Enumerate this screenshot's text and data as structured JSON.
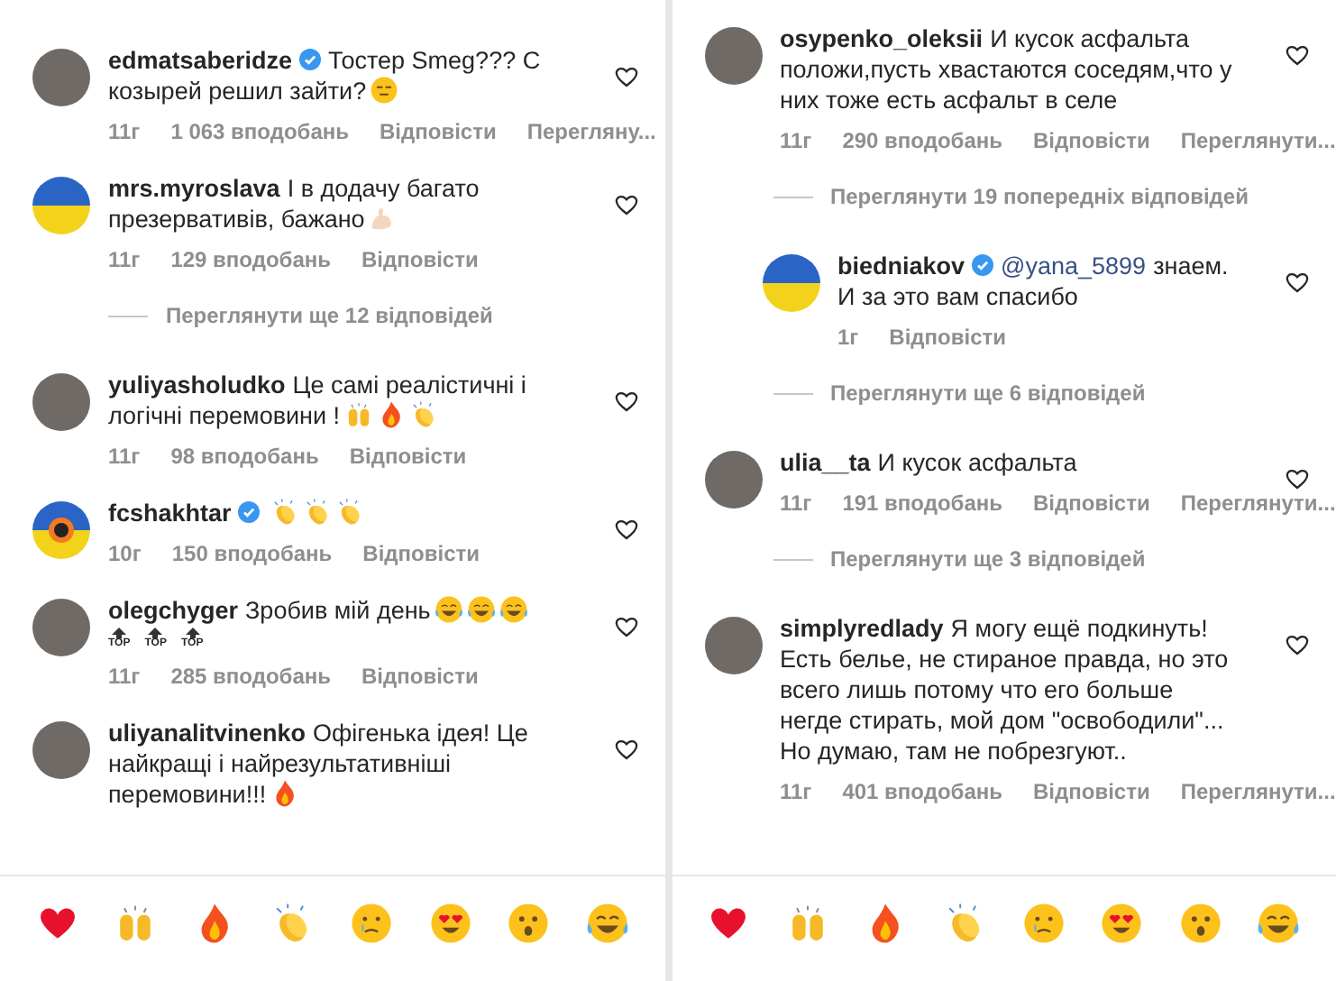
{
  "panels": [
    {
      "items": [
        {
          "kind": "comment",
          "avatar": {
            "kind": "photo"
          },
          "indented": false,
          "username": "edmatsaberidze",
          "verified": true,
          "text": "Тостер Smeg??? С козырей решил зайти?",
          "emojis": [
            {
              "kind": "expressionless"
            }
          ],
          "meta": {
            "time": "11г",
            "likes": "1 063 вподобань",
            "reply": "Відповісти",
            "view": "Перегляну..."
          }
        },
        {
          "kind": "comment",
          "avatar": {
            "kind": "flag"
          },
          "indented": false,
          "username": "mrs.myroslava",
          "verified": false,
          "text": "І в додачу багато презервативів, бажано",
          "emojis": [
            {
              "kind": "muscle"
            }
          ],
          "meta": {
            "time": "11г",
            "likes": "129 вподобань",
            "reply": "Відповісти"
          }
        },
        {
          "kind": "more",
          "label": "Переглянути ще 12 відповідей"
        },
        {
          "kind": "comment",
          "avatar": {
            "kind": "photo"
          },
          "indented": false,
          "username": "yuliyasholudko",
          "verified": false,
          "text": "Це самі реалістичні і логічні перемовини !",
          "emojis": [
            {
              "kind": "hands"
            },
            {
              "kind": "fire"
            },
            {
              "kind": "clap"
            }
          ],
          "meta": {
            "time": "11г",
            "likes": "98 вподобань",
            "reply": "Відповісти"
          }
        },
        {
          "kind": "comment",
          "avatar": {
            "kind": "crest"
          },
          "indented": false,
          "username": "fcshakhtar",
          "verified": true,
          "emojis": [
            {
              "kind": "clap"
            },
            {
              "kind": "clap"
            },
            {
              "kind": "clap"
            }
          ],
          "meta": {
            "time": "10г",
            "likes": "150 вподобань",
            "reply": "Відповісти"
          }
        },
        {
          "kind": "comment",
          "avatar": {
            "kind": "photo"
          },
          "indented": false,
          "username": "olegchyger",
          "verified": false,
          "text": "Зробив мій день",
          "emojis": [
            {
              "kind": "laughing"
            },
            {
              "kind": "laughing"
            },
            {
              "kind": "laughing"
            }
          ],
          "marks": [
            "TOP",
            "TOP",
            "TOP"
          ],
          "meta": {
            "time": "11г",
            "likes": "285 вподобань",
            "reply": "Відповісти"
          }
        },
        {
          "kind": "comment",
          "avatar": {
            "kind": "photo"
          },
          "indented": false,
          "username": "uliyanalitvinenko",
          "verified": false,
          "text": "Офігенька ідея! Це найкращі і найрезультативніші перемовини!!!",
          "emojis": [
            {
              "kind": "fire"
            }
          ]
        }
      ],
      "reactions": [
        {
          "kind": "heart"
        },
        {
          "kind": "hands"
        },
        {
          "kind": "fire"
        },
        {
          "kind": "clap"
        },
        {
          "kind": "crying"
        },
        {
          "kind": "hearteyes"
        },
        {
          "kind": "surprised"
        },
        {
          "kind": "laughing"
        }
      ]
    },
    {
      "items": [
        {
          "kind": "comment",
          "avatar": {
            "kind": "photo"
          },
          "indented": false,
          "username": "osypenko_oleksii",
          "verified": false,
          "text": "И кусок асфальта положи,пусть хвастаются соседям,что у них тоже есть асфальт в селе",
          "meta": {
            "time": "11г",
            "likes": "290 вподобань",
            "reply": "Відповісти",
            "view": "Переглянути..."
          }
        },
        {
          "kind": "more",
          "label": "Переглянути 19 попередніх відповідей"
        },
        {
          "kind": "comment",
          "avatar": {
            "kind": "flag"
          },
          "indented": true,
          "username": "biedniakov",
          "verified": true,
          "mention": "@yana_5899",
          "text": "знаем. И за это вам спасибо",
          "meta": {
            "time": "1г",
            "reply": "Відповісти"
          }
        },
        {
          "kind": "more",
          "label": "Переглянути ще 6 відповідей"
        },
        {
          "kind": "comment",
          "avatar": {
            "kind": "photo"
          },
          "indented": false,
          "username": "ulia__ta",
          "verified": false,
          "text": "И кусок асфальта",
          "meta": {
            "time": "11г",
            "likes": "191 вподобань",
            "reply": "Відповісти",
            "view": "Переглянути..."
          }
        },
        {
          "kind": "more",
          "label": "Переглянути ще 3 відповідей"
        },
        {
          "kind": "comment",
          "avatar": {
            "kind": "photo"
          },
          "indented": false,
          "username": "simplyredlady",
          "verified": false,
          "text": "Я могу ещё подкинуть! Есть белье, не стираное правда, но это всего лишь потому что его больше негде стирать, мой дом \"освободили\"... Но думаю, там не побрезгуют..",
          "meta": {
            "time": "11г",
            "likes": "401 вподобань",
            "reply": "Відповісти",
            "view": "Переглянути..."
          }
        }
      ],
      "reactions": [
        {
          "kind": "heart"
        },
        {
          "kind": "hands"
        },
        {
          "kind": "fire"
        },
        {
          "kind": "clap"
        },
        {
          "kind": "crying"
        },
        {
          "kind": "hearteyes"
        },
        {
          "kind": "surprised"
        },
        {
          "kind": "laughing"
        }
      ]
    }
  ]
}
